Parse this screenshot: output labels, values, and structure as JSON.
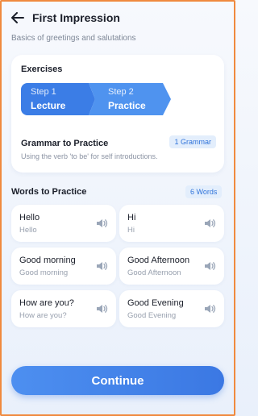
{
  "header": {
    "title": "First Impression",
    "subtitle": "Basics of greetings and salutations"
  },
  "exercises": {
    "title": "Exercises",
    "steps": [
      {
        "number": "Step 1",
        "name": "Lecture"
      },
      {
        "number": "Step 2",
        "name": "Practice"
      }
    ],
    "grammar_title": "Grammar to Practice",
    "grammar_badge": "1 Grammar",
    "grammar_desc": "Using the verb 'to be' for self introductions."
  },
  "words": {
    "title": "Words to Practice",
    "badge": "6 Words",
    "items": [
      {
        "text": "Hello",
        "sub": "Hello"
      },
      {
        "text": "Hi",
        "sub": "Hi"
      },
      {
        "text": "Good morning",
        "sub": "Good morning"
      },
      {
        "text": "Good Afternoon",
        "sub": "Good Afternoon"
      },
      {
        "text": "How are you?",
        "sub": "How are you?"
      },
      {
        "text": "Good Evening",
        "sub": "Good Evening"
      }
    ]
  },
  "continue_label": "Continue",
  "colors": {
    "accent": "#3b7de6",
    "frame": "#f08a3e"
  }
}
